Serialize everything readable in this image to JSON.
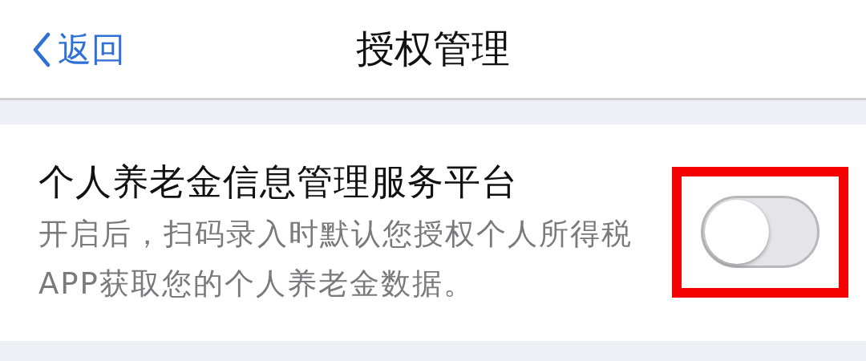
{
  "nav": {
    "back": "返回",
    "title": "授权管理"
  },
  "settings": [
    {
      "title": "个人养老金信息管理服务平台",
      "description": "开启后，扫码录入时默认您授权个人所得税APP获取您的个人养老金数据。",
      "on": false,
      "highlighted": true
    }
  ]
}
